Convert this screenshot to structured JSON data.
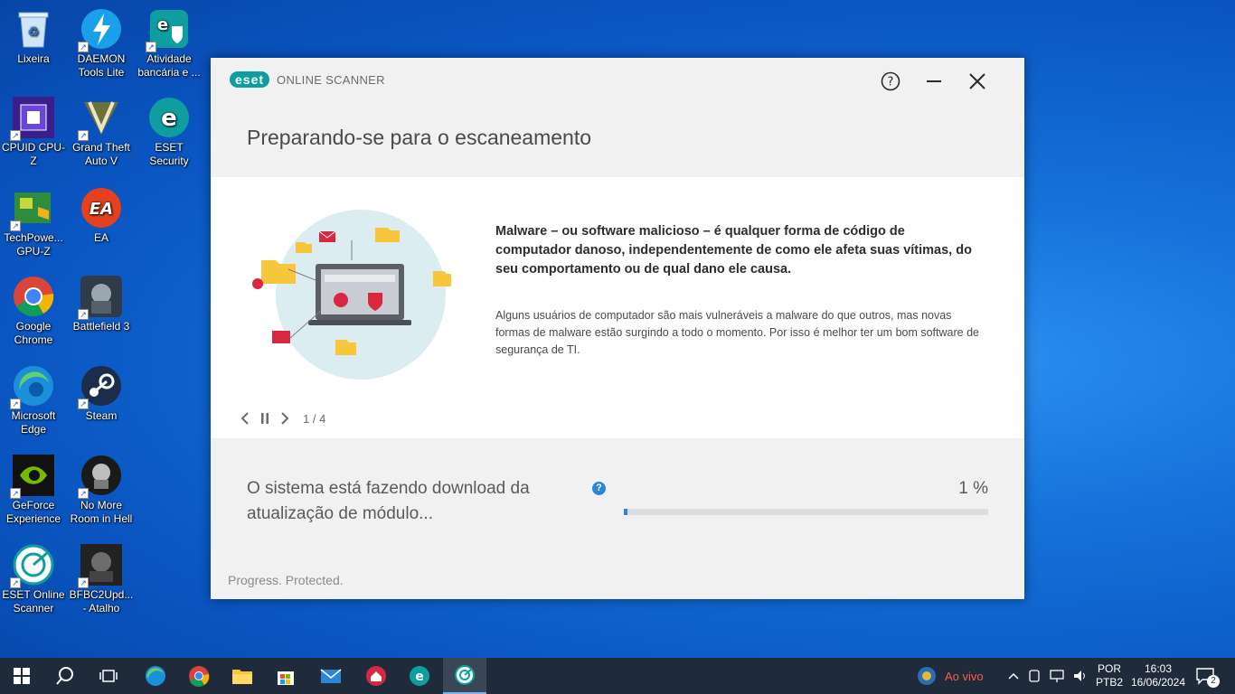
{
  "desktop": {
    "icons": [
      {
        "label": "Lixeira",
        "icon": "recycle-bin-icon"
      },
      {
        "label": "DAEMON Tools Lite",
        "icon": "daemon-tools-icon"
      },
      {
        "label": "Atividade bancária e ...",
        "icon": "eset-banking-icon"
      },
      {
        "label": "CPUID CPU-Z",
        "icon": "cpuz-icon"
      },
      {
        "label": "Grand Theft Auto V",
        "icon": "gta-icon"
      },
      {
        "label": "ESET Security",
        "icon": "eset-security-icon"
      },
      {
        "label": "TechPowe... GPU-Z",
        "icon": "gpuz-icon"
      },
      {
        "label": "EA",
        "icon": "ea-icon"
      },
      {
        "label": "Google Chrome",
        "icon": "chrome-icon"
      },
      {
        "label": "Battlefield 3",
        "icon": "battlefield-icon"
      },
      {
        "label": "Microsoft Edge",
        "icon": "edge-icon"
      },
      {
        "label": "Steam",
        "icon": "steam-icon"
      },
      {
        "label": "GeForce Experience",
        "icon": "geforce-icon"
      },
      {
        "label": "No More Room in Hell",
        "icon": "nmrih-icon"
      },
      {
        "label": "ESET Online Scanner",
        "icon": "eset-online-scanner-icon"
      },
      {
        "label": "BFBC2Upd... - Atalho",
        "icon": "bfbc2-icon"
      }
    ]
  },
  "window": {
    "logo_mark": "eset",
    "logo_text": "ONLINE SCANNER",
    "title": "Preparando-se para o escaneamento",
    "headline": "Malware – ou software malicioso – é qualquer forma de código de computador danoso, independentemente de como ele afeta suas vítimas, do seu comportamento ou de qual dano ele causa.",
    "body": "Alguns usuários de computador são mais vulneráveis a malware do que outros, mas novas formas de malware estão surgindo a todo o momento. Por isso é melhor ter um bom software de segurança de TI.",
    "carousel_page": "1 / 4",
    "status_text": "O sistema está fazendo download da atualização de módulo...",
    "percent_label": "1 %",
    "progress": 0.01,
    "footer": "Progress. Protected.",
    "accent": "#0e9ea0",
    "progress_color": "#2b85d8"
  },
  "taskbar": {
    "news_text": "Ao vivo",
    "lang_top": "POR",
    "lang_bottom": "PTB2",
    "time": "16:03",
    "date": "16/06/2024",
    "notification_count": "2"
  }
}
